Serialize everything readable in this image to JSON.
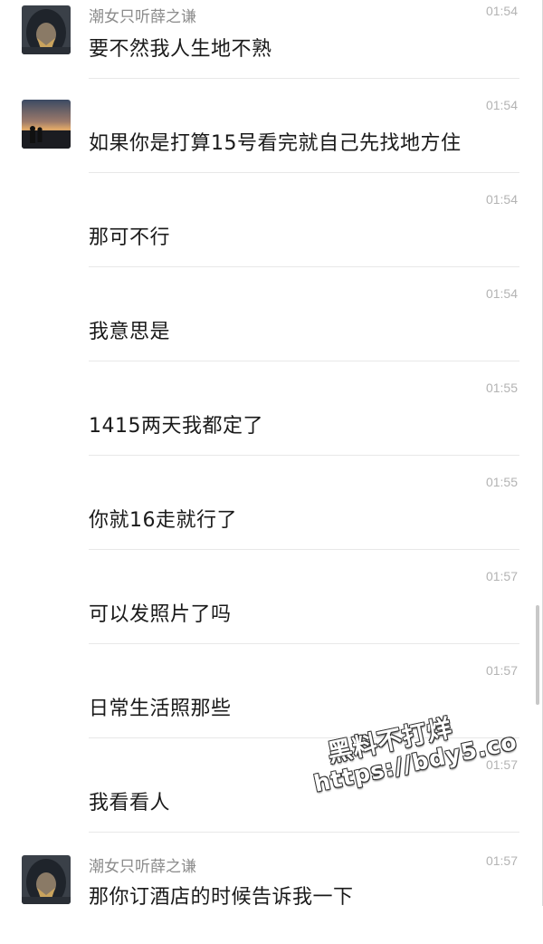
{
  "messages": [
    {
      "sender": "潮女只听薛之谦",
      "time": "01:54",
      "text": "要不然我人生地不熟",
      "avatar": "hooded-figure"
    },
    {
      "sender": "",
      "time": "01:54",
      "text": "如果你是打算15号看完就自己先找地方住",
      "avatar": "sunset-silhouette"
    },
    {
      "sender": "",
      "time": "01:54",
      "text": "那可不行",
      "avatar": ""
    },
    {
      "sender": "",
      "time": "01:54",
      "text": "我意思是",
      "avatar": ""
    },
    {
      "sender": "",
      "time": "01:55",
      "text": "1415两天我都定了",
      "avatar": ""
    },
    {
      "sender": "",
      "time": "01:55",
      "text": "你就16走就行了",
      "avatar": ""
    },
    {
      "sender": "",
      "time": "01:57",
      "text": "可以发照片了吗",
      "avatar": ""
    },
    {
      "sender": "",
      "time": "01:57",
      "text": "日常生活照那些",
      "avatar": ""
    },
    {
      "sender": "",
      "time": "01:57",
      "text": "我看看人",
      "avatar": ""
    },
    {
      "sender": "潮女只听薛之谦",
      "time": "01:57",
      "text": "那你订酒店的时候告诉我一下",
      "avatar": "hooded-figure"
    }
  ],
  "watermark": {
    "line1": "黑料不打烊",
    "line2": "https://bdy5.co"
  },
  "colors": {
    "background": "#ffffff",
    "text": "#1a1a1a",
    "sender": "#8c8c8c",
    "time": "#b3b3b3",
    "divider": "#e8e8e8"
  }
}
